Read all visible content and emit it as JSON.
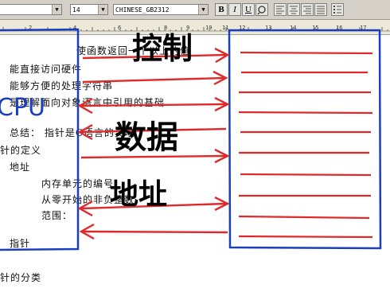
{
  "toolbar": {
    "font_size": "14",
    "font_name": "CHINESE_GB2312",
    "bold_label": "B",
    "italic_label": "I",
    "underline_label": "U"
  },
  "ruler": {
    "numbers": [
      "2",
      "4",
      "6",
      "8",
      "9",
      "10",
      "11",
      "12",
      "13",
      "14",
      "15",
      "16",
      "17"
    ]
  },
  "document": {
    "lines": [
      "使函数返回一个以上的值",
      "能直接访问硬件",
      "能够方便的处理字符串",
      "是理解面向对象语言中引用的基础",
      "总结：  指针是C语言的灵魂",
      "针的定义",
      "地址",
      "内存单元的编号",
      "从零开始的非负整数",
      "范围：",
      "指针",
      "针的分类"
    ]
  },
  "annotations": {
    "left_box_label": "CPU",
    "top_label": "控制",
    "middle_label": "数据",
    "bottom_label": "地址",
    "colors": {
      "blue": "#1b3ec0",
      "red": "#e02a2a"
    }
  }
}
